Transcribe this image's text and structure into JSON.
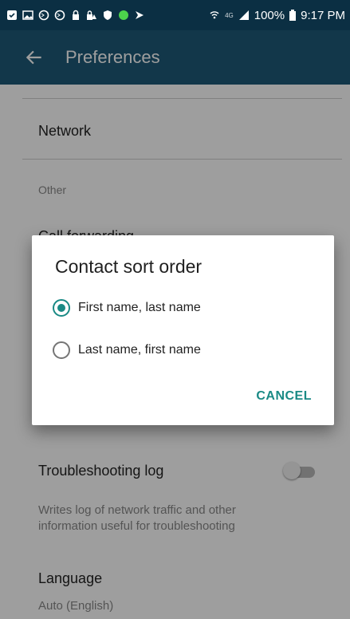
{
  "status_bar": {
    "network": "4G",
    "battery": "100%",
    "time": "9:17 PM"
  },
  "app_bar": {
    "title": "Preferences"
  },
  "settings": {
    "network_label": "Network",
    "other_section": "Other",
    "partial_label": "Call forwarding",
    "troubleshooting_label": "Troubleshooting log",
    "troubleshooting_summary_line1": "Writes log of network traffic and other",
    "troubleshooting_summary_line2": "information useful for troubleshooting",
    "language_label": "Language",
    "language_value": "Auto (English)"
  },
  "dialog": {
    "title": "Contact sort order",
    "options": [
      {
        "label": "First name, last name",
        "selected": true
      },
      {
        "label": "Last name, first name",
        "selected": false
      }
    ],
    "cancel_label": "CANCEL"
  },
  "colors": {
    "status_bar": "#0b2f43",
    "app_bar": "#1e5a78",
    "accent": "#1a8a85"
  }
}
